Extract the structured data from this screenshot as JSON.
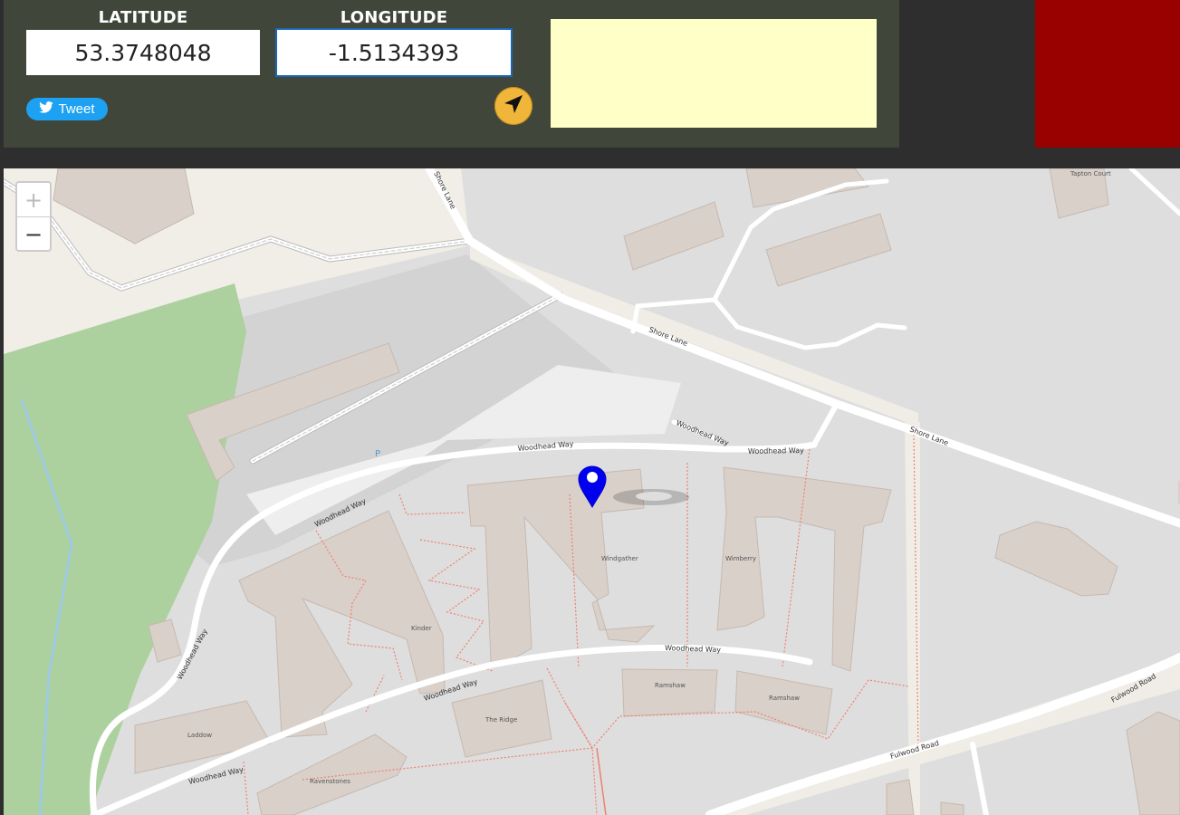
{
  "latitude": {
    "label": "LATITUDE",
    "value": "53.3748048"
  },
  "longitude": {
    "label": "LONGITUDE",
    "value": "-1.5134393"
  },
  "tweet_button": {
    "label": "Tweet",
    "icon": "twitter-bird-icon"
  },
  "locate_button": {
    "icon": "navigation-arrow-icon"
  },
  "colors": {
    "panel": "#40473a",
    "info_box": "#ffffc8",
    "alert": "#990000",
    "tweet": "#1da1f2",
    "marker": "#0000ee"
  },
  "map": {
    "zoom_in": "+",
    "zoom_out": "−",
    "roads": [
      {
        "id": "shore-lane-a",
        "label": "Shore Lane"
      },
      {
        "id": "shore-lane-b",
        "label": "Shore Lane"
      },
      {
        "id": "shore-lane-c",
        "label": "Shore Lane"
      },
      {
        "id": "woodhead-1",
        "label": "Woodhead Way"
      },
      {
        "id": "woodhead-2",
        "label": "Woodhead Way"
      },
      {
        "id": "woodhead-3",
        "label": "Woodhead Way"
      },
      {
        "id": "woodhead-4",
        "label": "Woodhead Way"
      },
      {
        "id": "woodhead-5",
        "label": "Woodhead Way"
      },
      {
        "id": "woodhead-6",
        "label": "Woodhead Way"
      },
      {
        "id": "woodhead-7",
        "label": "Woodhead Way"
      },
      {
        "id": "woodhead-8",
        "label": "Woodhead Way"
      },
      {
        "id": "fulwood-1",
        "label": "Fulwood Road"
      },
      {
        "id": "fulwood-2",
        "label": "Fulwood Road"
      }
    ],
    "buildings": [
      "Tapton Court",
      "Windgather",
      "Wimberry",
      "Kinder",
      "Ramshaw",
      "Ramshaw",
      "The Ridge",
      "Laddow",
      "Ravenstones"
    ],
    "parking": "P"
  }
}
